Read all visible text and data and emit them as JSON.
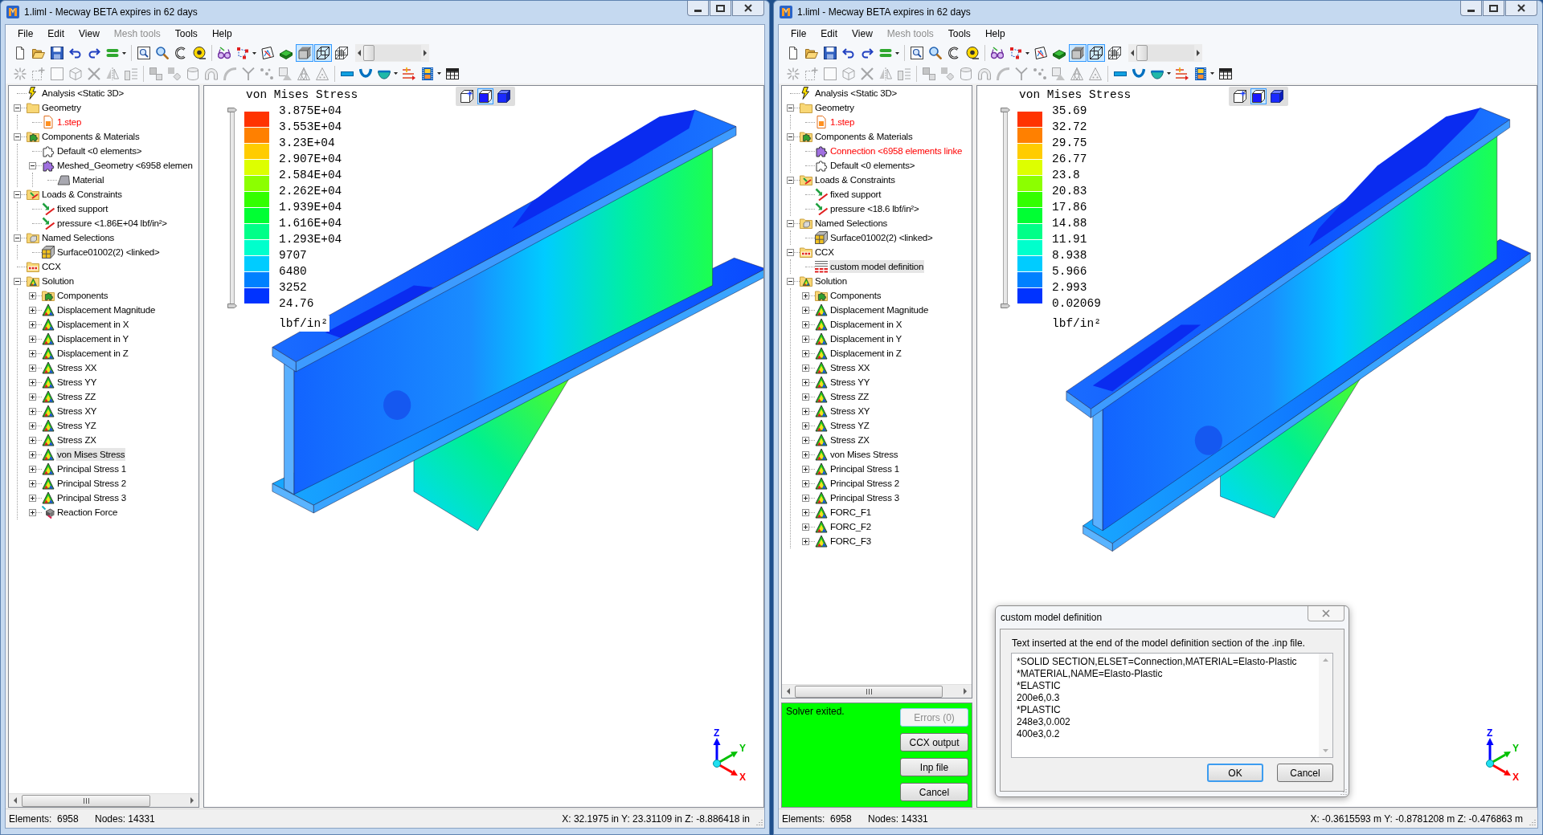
{
  "windows": [
    {
      "title": "1.liml - Mecway BETA expires in 62 days",
      "menu": [
        {
          "label": "File",
          "disabled": false
        },
        {
          "label": "Edit",
          "disabled": false
        },
        {
          "label": "View",
          "disabled": false
        },
        {
          "label": "Mesh tools",
          "disabled": true
        },
        {
          "label": "Tools",
          "disabled": false
        },
        {
          "label": "Help",
          "disabled": false
        }
      ],
      "toolbar_1": [
        {
          "pressed": false
        },
        {
          "pressed": false
        },
        {
          "pressed": false
        },
        {
          "pressed": false
        },
        {
          "pressed": false
        },
        {
          "pressed": false
        },
        {
          "pressed": false
        },
        {
          "pressed": false
        },
        {
          "pressed": false
        },
        {
          "pressed": false
        },
        {
          "pressed": false
        },
        {
          "pressed": false
        },
        {
          "pressed": false
        },
        {
          "pressed": false
        },
        {
          "pressed": true
        },
        {
          "pressed": true
        },
        {
          "pressed": false
        }
      ],
      "frame_slider": {
        "level": 0
      },
      "toolbar_2": [
        {
          "disabled": true
        },
        {
          "disabled": true
        },
        {
          "disabled": true
        },
        {
          "disabled": true
        },
        {
          "disabled": true
        },
        {
          "disabled": true
        },
        {
          "disabled": true
        },
        {
          "disabled": true
        },
        {
          "disabled": true
        },
        {
          "disabled": true
        },
        {
          "disabled": true
        },
        {
          "disabled": true
        },
        {
          "disabled": true
        },
        {
          "disabled": true
        },
        {
          "disabled": true
        },
        {
          "disabled": true
        },
        {
          "disabled": true
        },
        {
          "disabled": false
        },
        {
          "disabled": false
        },
        {
          "disabled": false
        },
        {
          "disabled": false
        },
        {
          "disabled": false
        },
        {
          "disabled": false
        }
      ],
      "tree": [
        {
          "label": "Analysis <Static 3D>",
          "kind": "analysis",
          "selected": false
        },
        {
          "label": "Geometry",
          "kind": "folder",
          "expanded": true,
          "selected": false,
          "children": [
            {
              "label": "1.step",
              "kind": "file",
              "selected": false,
              "color": "#ff0000"
            }
          ]
        },
        {
          "label": "Components & Materials",
          "kind": "components",
          "expanded": true,
          "selected": false,
          "children": [
            {
              "label": "Default <0 elements>",
              "kind": "part",
              "selected": false
            },
            {
              "label": "Meshed_Geometry <6958 elemen",
              "kind": "meshed-part",
              "expanded": true,
              "selected": false,
              "children": [
                {
                  "label": "Material",
                  "kind": "material",
                  "selected": false
                }
              ]
            }
          ]
        },
        {
          "label": "Loads & Constraints",
          "kind": "loads",
          "expanded": true,
          "selected": false,
          "children": [
            {
              "label": "fixed support",
              "kind": "load",
              "selected": false
            },
            {
              "label": "pressure <1.86E+04 lbf/in²>",
              "kind": "load",
              "selected": false
            }
          ]
        },
        {
          "label": "Named Selections",
          "kind": "selections",
          "expanded": true,
          "selected": false,
          "children": [
            {
              "label": "Surface01002(2) <linked>",
              "kind": "selection",
              "selected": false
            }
          ]
        },
        {
          "label": "CCX",
          "kind": "ccx",
          "selected": false
        },
        {
          "label": "Solution",
          "kind": "solution",
          "expanded": true,
          "selected": false,
          "children": [
            {
              "label": "Components",
              "kind": "components",
              "expanded": false,
              "selected": false
            },
            {
              "label": "Displacement Magnitude",
              "kind": "result",
              "expanded": false,
              "selected": false
            },
            {
              "label": "Displacement in X",
              "kind": "result",
              "expanded": false,
              "selected": false
            },
            {
              "label": "Displacement in Y",
              "kind": "result",
              "expanded": false,
              "selected": false
            },
            {
              "label": "Displacement in Z",
              "kind": "result",
              "expanded": false,
              "selected": false
            },
            {
              "label": "Stress XX",
              "kind": "result",
              "expanded": false,
              "selected": false
            },
            {
              "label": "Stress YY",
              "kind": "result",
              "expanded": false,
              "selected": false
            },
            {
              "label": "Stress ZZ",
              "kind": "result",
              "expanded": false,
              "selected": false
            },
            {
              "label": "Stress XY",
              "kind": "result",
              "expanded": false,
              "selected": false
            },
            {
              "label": "Stress YZ",
              "kind": "result",
              "expanded": false,
              "selected": false
            },
            {
              "label": "Stress ZX",
              "kind": "result",
              "expanded": false,
              "selected": false
            },
            {
              "label": "von Mises Stress",
              "kind": "result",
              "expanded": false,
              "selected": true
            },
            {
              "label": "Principal Stress 1",
              "kind": "result",
              "expanded": false,
              "selected": false
            },
            {
              "label": "Principal Stress 2",
              "kind": "result",
              "expanded": false,
              "selected": false
            },
            {
              "label": "Principal Stress 3",
              "kind": "result",
              "expanded": false,
              "selected": false
            },
            {
              "label": "Reaction Force",
              "kind": "reaction",
              "expanded": false,
              "selected": false
            }
          ]
        }
      ],
      "legend": {
        "title": "von Mises Stress",
        "ticks": [
          "3.875E+04",
          "3.553E+04",
          "3.23E+04",
          "2.907E+04",
          "2.584E+04",
          "2.262E+04",
          "1.939E+04",
          "1.616E+04",
          "1.293E+04",
          "9707",
          "6480",
          "3252",
          "24.76"
        ],
        "bands": [
          {
            "color": "#ff3300"
          },
          {
            "color": "#ff8000"
          },
          {
            "color": "#ffcc00"
          },
          {
            "color": "#ddff00"
          },
          {
            "color": "#8cff00"
          },
          {
            "color": "#33ff00"
          },
          {
            "color": "#00ff33"
          },
          {
            "color": "#00ff88"
          },
          {
            "color": "#00ffcc"
          },
          {
            "color": "#00ccff"
          },
          {
            "color": "#0080ff"
          },
          {
            "color": "#0033ff"
          }
        ],
        "unit": "lbf/in²"
      },
      "view_buttons": [
        {
          "selected": false
        },
        {
          "selected": true
        },
        {
          "selected": false
        }
      ],
      "axes": [
        {
          "label": "Z",
          "color": "#0000ff"
        },
        {
          "label": "Y",
          "color": "#00c000"
        },
        {
          "label": "X",
          "color": "#ff0000"
        }
      ],
      "status_bar": {
        "elements": "Elements:  6958",
        "nodes": "Nodes: 14331",
        "coordinates": "X: 32.1975 in Y: 23.31109 in Z: -8.886418 in"
      }
    },
    {
      "title": "1.liml - Mecway BETA expires in 62 days",
      "menu": [
        {
          "label": "File",
          "disabled": false
        },
        {
          "label": "Edit",
          "disabled": false
        },
        {
          "label": "View",
          "disabled": false
        },
        {
          "label": "Mesh tools",
          "disabled": true
        },
        {
          "label": "Tools",
          "disabled": false
        },
        {
          "label": "Help",
          "disabled": false
        }
      ],
      "toolbar_1": [
        {
          "pressed": false
        },
        {
          "pressed": false
        },
        {
          "pressed": false
        },
        {
          "pressed": false
        },
        {
          "pressed": false
        },
        {
          "pressed": false
        },
        {
          "pressed": false
        },
        {
          "pressed": false
        },
        {
          "pressed": false
        },
        {
          "pressed": false
        },
        {
          "pressed": false
        },
        {
          "pressed": false
        },
        {
          "pressed": false
        },
        {
          "pressed": false
        },
        {
          "pressed": true
        },
        {
          "pressed": true
        },
        {
          "pressed": false
        }
      ],
      "frame_slider": {
        "level": 0
      },
      "toolbar_2": [
        {
          "disabled": true
        },
        {
          "disabled": true
        },
        {
          "disabled": true
        },
        {
          "disabled": true
        },
        {
          "disabled": true
        },
        {
          "disabled": true
        },
        {
          "disabled": true
        },
        {
          "disabled": true
        },
        {
          "disabled": true
        },
        {
          "disabled": true
        },
        {
          "disabled": true
        },
        {
          "disabled": true
        },
        {
          "disabled": true
        },
        {
          "disabled": true
        },
        {
          "disabled": true
        },
        {
          "disabled": true
        },
        {
          "disabled": true
        },
        {
          "disabled": false
        },
        {
          "disabled": false
        },
        {
          "disabled": false
        },
        {
          "disabled": false
        },
        {
          "disabled": false
        },
        {
          "disabled": false
        }
      ],
      "tree": [
        {
          "label": "Analysis <Static 3D>",
          "kind": "analysis",
          "selected": false
        },
        {
          "label": "Geometry",
          "kind": "folder",
          "expanded": true,
          "selected": false,
          "children": [
            {
              "label": "1.step",
              "kind": "file",
              "selected": false,
              "color": "#ff0000"
            }
          ]
        },
        {
          "label": "Components & Materials",
          "kind": "components",
          "expanded": true,
          "selected": false,
          "children": [
            {
              "label": "Connection <6958 elements linke",
              "kind": "meshed-part",
              "selected": false,
              "color": "#ff0000"
            },
            {
              "label": "Default <0 elements>",
              "kind": "part",
              "selected": false
            }
          ]
        },
        {
          "label": "Loads & Constraints",
          "kind": "loads",
          "expanded": true,
          "selected": false,
          "children": [
            {
              "label": "fixed support",
              "kind": "load",
              "selected": false
            },
            {
              "label": "pressure <18.6 lbf/in²>",
              "kind": "load",
              "selected": false
            }
          ]
        },
        {
          "label": "Named Selections",
          "kind": "selections",
          "expanded": true,
          "selected": false,
          "children": [
            {
              "label": "Surface01002(2) <linked>",
              "kind": "selection",
              "selected": false
            }
          ]
        },
        {
          "label": "CCX",
          "kind": "ccx",
          "expanded": true,
          "selected": false,
          "children": [
            {
              "label": "custom model definition",
              "kind": "ccx-item",
              "selected": true
            }
          ]
        },
        {
          "label": "Solution",
          "kind": "solution",
          "expanded": true,
          "selected": false,
          "children": [
            {
              "label": "Components",
              "kind": "components",
              "expanded": false,
              "selected": false
            },
            {
              "label": "Displacement Magnitude",
              "kind": "result",
              "expanded": false,
              "selected": false
            },
            {
              "label": "Displacement in X",
              "kind": "result",
              "expanded": false,
              "selected": false
            },
            {
              "label": "Displacement in Y",
              "kind": "result",
              "expanded": false,
              "selected": false
            },
            {
              "label": "Displacement in Z",
              "kind": "result",
              "expanded": false,
              "selected": false
            },
            {
              "label": "Stress XX",
              "kind": "result",
              "expanded": false,
              "selected": false
            },
            {
              "label": "Stress YY",
              "kind": "result",
              "expanded": false,
              "selected": false
            },
            {
              "label": "Stress ZZ",
              "kind": "result",
              "expanded": false,
              "selected": false
            },
            {
              "label": "Stress XY",
              "kind": "result",
              "expanded": false,
              "selected": false
            },
            {
              "label": "Stress YZ",
              "kind": "result",
              "expanded": false,
              "selected": false
            },
            {
              "label": "Stress ZX",
              "kind": "result",
              "expanded": false,
              "selected": false
            },
            {
              "label": "von Mises Stress",
              "kind": "result",
              "expanded": false,
              "selected": false
            },
            {
              "label": "Principal Stress 1",
              "kind": "result",
              "expanded": false,
              "selected": false
            },
            {
              "label": "Principal Stress 2",
              "kind": "result",
              "expanded": false,
              "selected": false
            },
            {
              "label": "Principal Stress 3",
              "kind": "result",
              "expanded": false,
              "selected": false
            },
            {
              "label": "FORC_F1",
              "kind": "result",
              "expanded": false,
              "selected": false
            },
            {
              "label": "FORC_F2",
              "kind": "result",
              "expanded": false,
              "selected": false
            },
            {
              "label": "FORC_F3",
              "kind": "result",
              "expanded": false,
              "selected": false
            }
          ]
        }
      ],
      "solver": {
        "message": "Solver exited.",
        "buttons": [
          {
            "label": "Errors (0)",
            "disabled": true
          },
          {
            "label": "CCX output",
            "disabled": false
          },
          {
            "label": "Inp file",
            "disabled": false
          },
          {
            "label": "Cancel",
            "disabled": false
          }
        ]
      },
      "legend": {
        "title": "von Mises Stress",
        "ticks": [
          "35.69",
          "32.72",
          "29.75",
          "26.77",
          "23.8",
          "20.83",
          "17.86",
          "14.88",
          "11.91",
          "8.938",
          "5.966",
          "2.993",
          "0.02069"
        ],
        "bands": [
          {
            "color": "#ff3300"
          },
          {
            "color": "#ff8000"
          },
          {
            "color": "#ffcc00"
          },
          {
            "color": "#ddff00"
          },
          {
            "color": "#8cff00"
          },
          {
            "color": "#33ff00"
          },
          {
            "color": "#00ff33"
          },
          {
            "color": "#00ff88"
          },
          {
            "color": "#00ffcc"
          },
          {
            "color": "#00ccff"
          },
          {
            "color": "#0080ff"
          },
          {
            "color": "#0033ff"
          }
        ],
        "unit": "lbf/in²"
      },
      "view_buttons": [
        {
          "selected": false
        },
        {
          "selected": true
        },
        {
          "selected": false
        }
      ],
      "axes": [
        {
          "label": "Z",
          "color": "#0000ff"
        },
        {
          "label": "Y",
          "color": "#00c000"
        },
        {
          "label": "X",
          "color": "#ff0000"
        }
      ],
      "dialog": {
        "title": "custom model definition",
        "description": "Text inserted at the end of the model definition section of the .inp file.",
        "value": "*SOLID SECTION,ELSET=Connection,MATERIAL=Elasto-Plastic\n*MATERIAL,NAME=Elasto-Plastic\n*ELASTIC\n200e6,0.3\n*PLASTIC\n248e3,0.002\n400e3,0.2",
        "buttons": [
          {
            "label": "OK",
            "default": true
          },
          {
            "label": "Cancel",
            "default": false
          }
        ]
      },
      "status_bar": {
        "elements": "Elements:  6958",
        "nodes": "Nodes: 14331",
        "coordinates": "X: -0.3615593 m Y: -0.8781208 m Z: -0.476863 m"
      }
    }
  ]
}
